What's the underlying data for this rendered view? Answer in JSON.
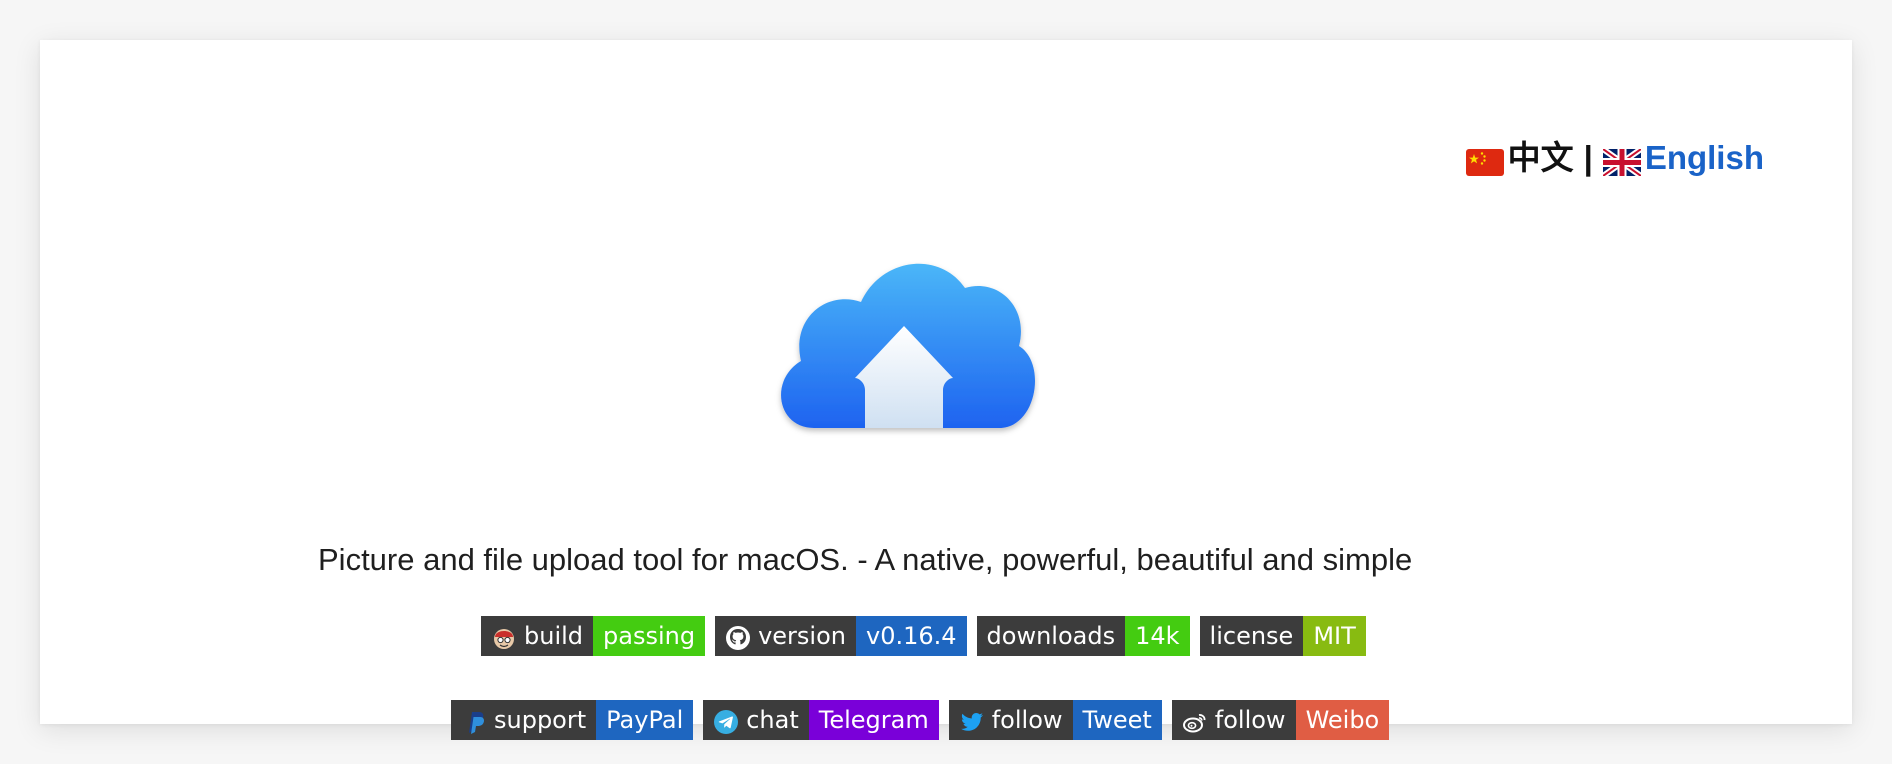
{
  "language_switch": {
    "chinese_label": "中文",
    "separator": "|",
    "english_label": "English",
    "chinese_flag_icon": "china-flag-icon",
    "english_flag_icon": "uk-flag-icon"
  },
  "logo": {
    "icon": "cloud-upload-icon"
  },
  "tagline": "Picture and file upload tool for macOS. - A native, powerful, beautiful and simple",
  "badges_row1": [
    {
      "icon": "travis-ci-icon",
      "label": "build",
      "value": "passing",
      "color": "#44cc11"
    },
    {
      "icon": "github-icon",
      "label": "version",
      "value": "v0.16.4",
      "color": "#1e66c0"
    },
    {
      "icon": "",
      "label": "downloads",
      "value": "14k",
      "color": "#44cc11"
    },
    {
      "icon": "",
      "label": "license",
      "value": "MIT",
      "color": "#88bb11"
    }
  ],
  "badges_row2": [
    {
      "icon": "paypal-icon",
      "label": "support",
      "value": "PayPal",
      "color": "#1e66c0"
    },
    {
      "icon": "telegram-icon",
      "label": "chat",
      "value": "Telegram",
      "color": "#7a00d9"
    },
    {
      "icon": "twitter-icon",
      "label": "follow",
      "value": "Tweet",
      "color": "#1e66c0"
    },
    {
      "icon": "weibo-icon",
      "label": "follow",
      "value": "Weibo",
      "color": "#e05d44"
    }
  ],
  "colors": {
    "link": "#1a63c8",
    "badge_left_bg": "#3c3c3c"
  }
}
